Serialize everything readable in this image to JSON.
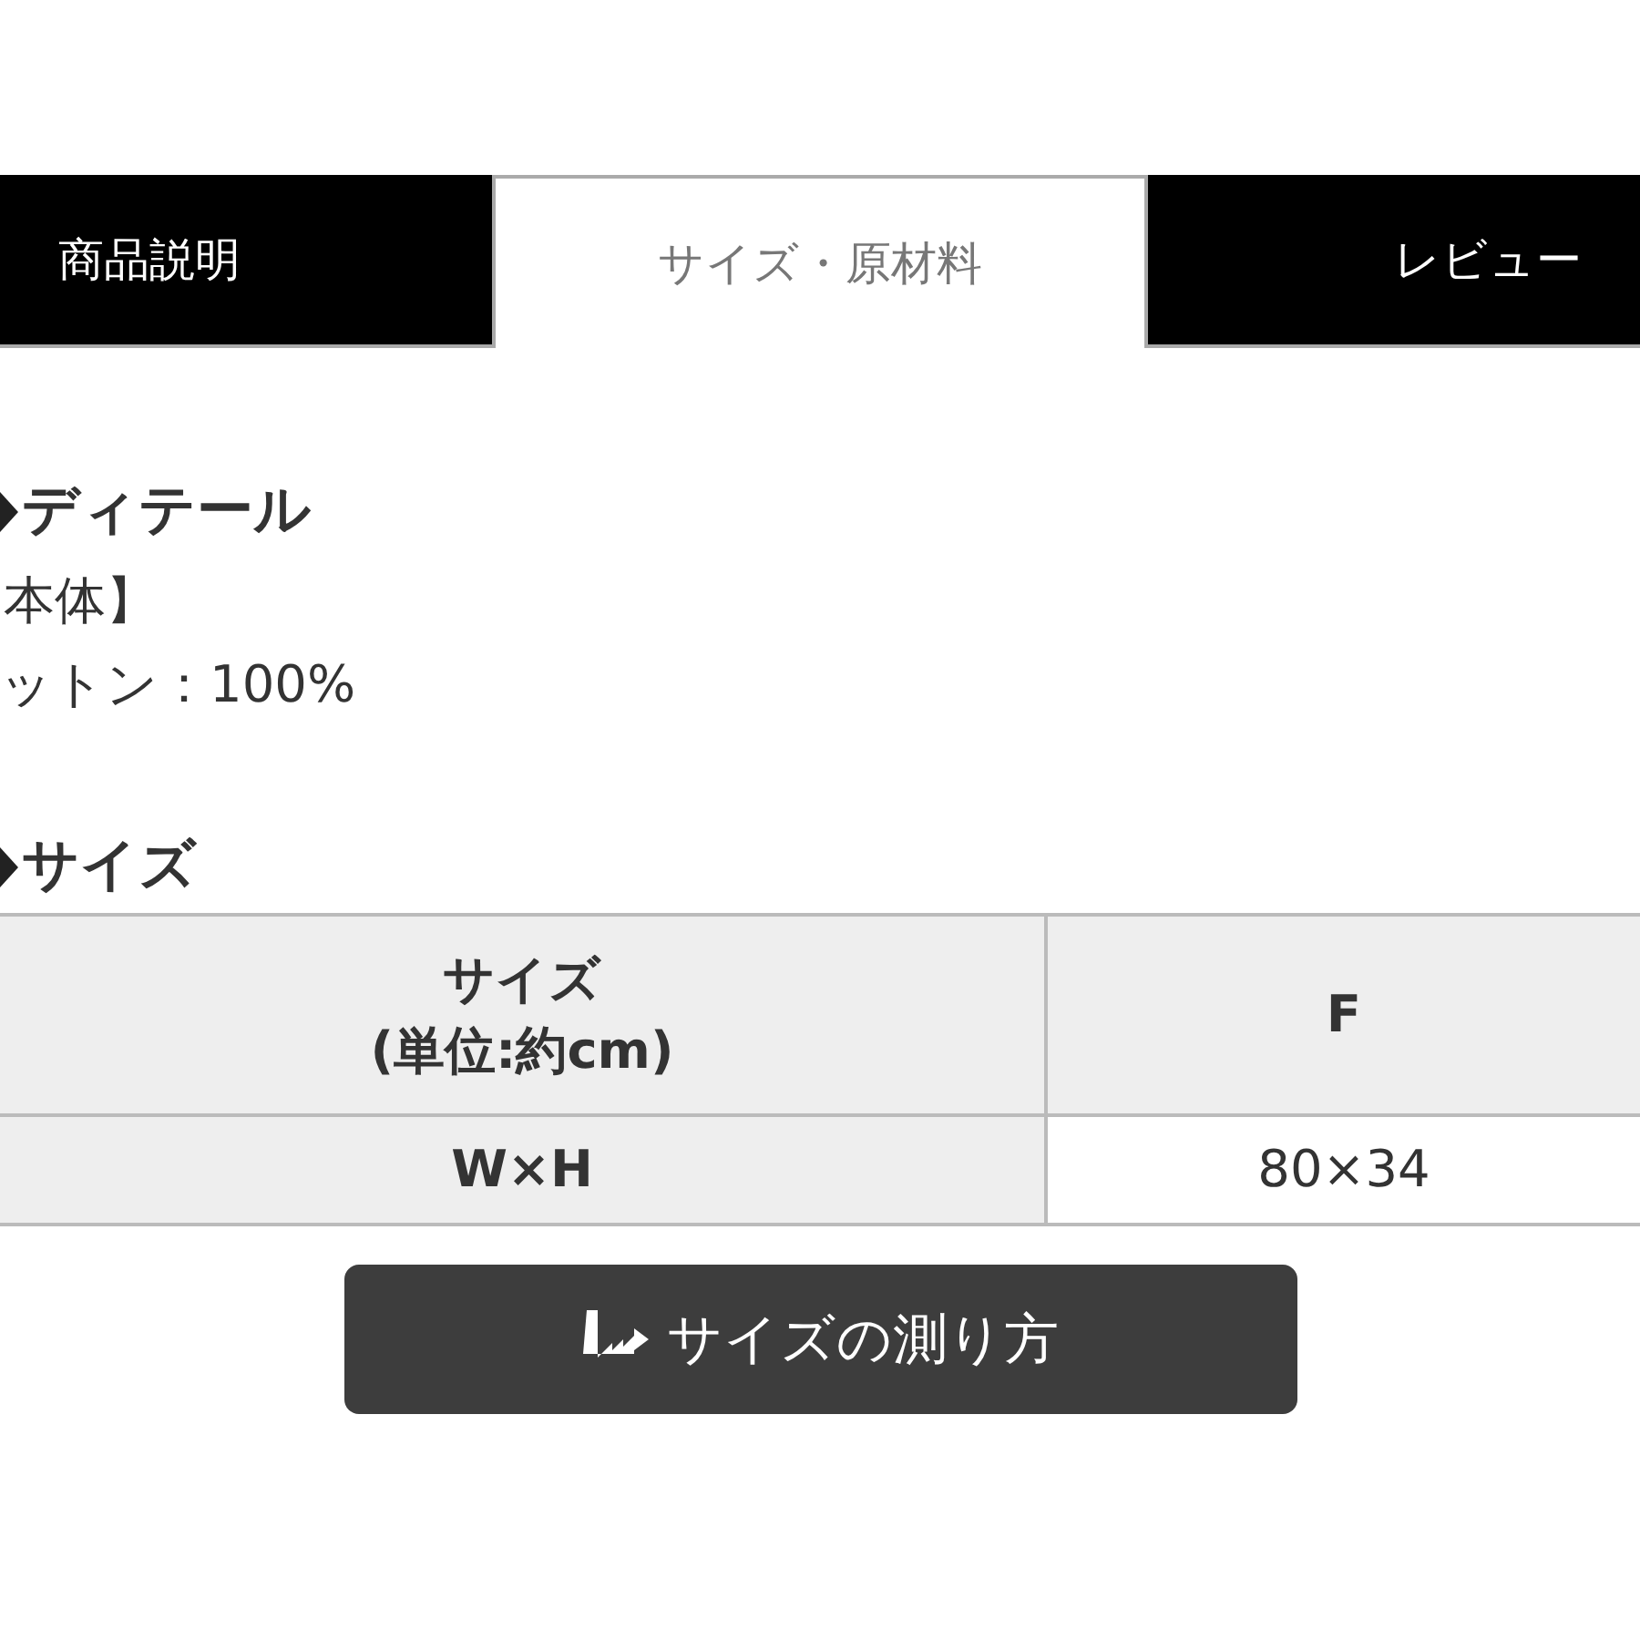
{
  "tabs": [
    {
      "label": "商品説明",
      "selected": false
    },
    {
      "label": "サイズ・原材料",
      "selected": true
    },
    {
      "label": "レビュー",
      "selected": false
    }
  ],
  "sections": [
    {
      "heading": "ディテール",
      "lines": [
        "本体】",
        "ットン：100%"
      ]
    },
    {
      "heading": "サイズ"
    }
  ],
  "size_table": {
    "header": [
      "サイズ\n(単位:約cm)",
      "F"
    ],
    "rows": [
      [
        "W×H",
        "80×34"
      ]
    ]
  },
  "measure_button": {
    "label": "サイズの測り方"
  }
}
